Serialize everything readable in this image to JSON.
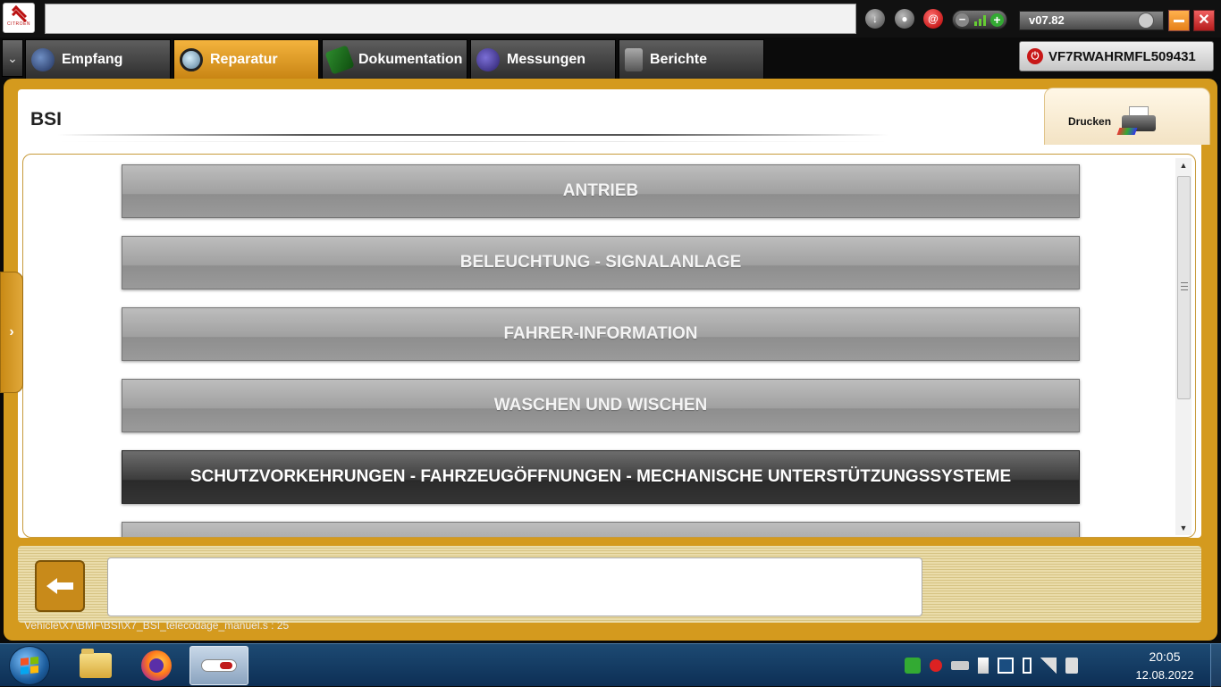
{
  "header": {
    "logo_text": "CITROËN",
    "address_value": "",
    "version": "v07.82",
    "icons": [
      "download-icon",
      "user-icon",
      "at-icon",
      "zoom-control",
      "clock-icon",
      "minimize-icon",
      "close-icon"
    ]
  },
  "tabs": [
    {
      "label": "Empfang",
      "icon": "globe-icon",
      "active": false
    },
    {
      "label": "Reparatur",
      "icon": "magnifier-icon",
      "active": true
    },
    {
      "label": "Dokumentation",
      "icon": "book-icon",
      "active": false
    },
    {
      "label": "Messungen",
      "icon": "waveform-icon",
      "active": false
    },
    {
      "label": "Berichte",
      "icon": "report-icon",
      "active": false
    }
  ],
  "vin": {
    "value": "VF7RWAHRMFL509431",
    "icon": "power-icon"
  },
  "page": {
    "title": "BSI",
    "print_label": "Drucken",
    "items": [
      {
        "label": "ANTRIEB",
        "selected": false
      },
      {
        "label": "BELEUCHTUNG - SIGNALANLAGE",
        "selected": false
      },
      {
        "label": "FAHRER-INFORMATION",
        "selected": false
      },
      {
        "label": "WASCHEN UND WISCHEN",
        "selected": false
      },
      {
        "label": "SCHUTZVORKEHRUNGEN - FAHRZEUGÖFFNUNGEN - MECHANISCHE UNTERSTÜTZUNGSSYSTEME",
        "selected": true
      },
      {
        "label": "",
        "selected": false
      }
    ]
  },
  "bottom": {
    "message": "",
    "status_path": "Vehicle\\X7\\BMF\\BSI\\X7_BSI_telecodage_manuel.s : 25"
  },
  "taskbar": {
    "apps": [
      "windows-explorer",
      "firefox",
      "diagbox"
    ],
    "time": "20:05",
    "date": "12.08.2022"
  },
  "colors": {
    "accent": "#d49a1e",
    "active_tab": "#f4b33d",
    "item_gray": "#a0a0a0",
    "item_selected": "#3c3c3c",
    "close_red": "#c81818"
  }
}
